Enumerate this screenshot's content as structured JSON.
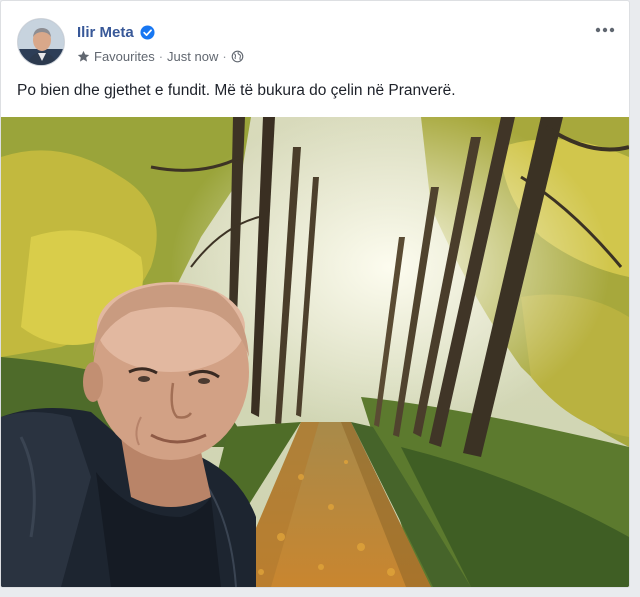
{
  "post": {
    "author": "Ilir Meta",
    "audience_label": "Favourites",
    "timestamp": "Just now",
    "separator": "·",
    "text": "Po bien dhe gjethet e fundit. Më të bukura do çelin në Pranverë.",
    "more_label": "•••"
  },
  "icons": {
    "verified": "verified-badge-icon",
    "favourites": "star-icon",
    "privacy": "globe-icon",
    "more": "more-options-icon"
  },
  "colors": {
    "author_link": "#385898",
    "verified_badge": "#1877f2",
    "meta_text": "#616770",
    "post_text": "#1d2129"
  }
}
